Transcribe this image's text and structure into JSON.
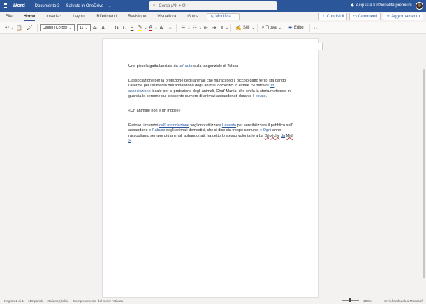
{
  "topbar": {
    "app_name": "Word",
    "doc_title": "Documento 3",
    "save_status": "Salvato in OneDrive",
    "search_placeholder": "Cerca (Alt + Q)",
    "premium_label": "Acquista funzionalità premium"
  },
  "tabs": [
    "File",
    "Home",
    "Inserisci",
    "Layout",
    "Riferimenti",
    "Revisione",
    "Visualizza",
    "Guida"
  ],
  "active_tab": "Home",
  "edit_mode": "Modifica",
  "actions": {
    "share": "Condividi",
    "comments": "Commenti",
    "catchup": "Aggiornamento"
  },
  "ribbon": {
    "font_name": "Calibri (Corpo)",
    "font_size": "11",
    "styles": "Stili",
    "find": "Trova",
    "editor": "Editor"
  },
  "document": {
    "p1_a": "Una piccola gatta lanciata da ",
    "p1_link": "un' auto",
    "p1_b": " sulla tangenziale di Tolosa",
    "p2_a": "L'associazione per la protezione degli animali che ha raccolto il piccolo gatto ferito sta dando l'allarme per l'aumento dell'abbandono degli animali domestici in estate. Si tratta di ",
    "p2_link1": "un' associazione",
    "p2_b": " locale per la protezione degli animali, Chat' Mania, che svela la storia mettendo in guardia le persone sul crescente numero di animali abbandonati durante ",
    "p2_link2": "l' estate",
    "p2_c": ".",
    "p3": "«Un animale non è un mobile»",
    "p4_a": "Furioso, i membri ",
    "p4_link1": "dell' associazione",
    "p4_b": " vogliono utilizzare ",
    "p4_link2": "l' evento",
    "p4_c": " per sensibilizzare il pubblico sull' abbandono e ",
    "p4_link3": "l' abuso",
    "p4_d": " degli animali domestici, che si dice sia troppo comune. ",
    "p4_link4": "« Ogni",
    "p4_e": " anno raccogliamo sempre più animali abbandonati, ha detto lo stesso volontario a La ",
    "p4_red1": "Dépêche",
    "p4_f": " ",
    "p4_link5": "du",
    "p4_g": " ",
    "p4_red2": "Midi",
    "p4_h": "",
    "p4_link6": " »",
    "p4_i": "."
  },
  "status": {
    "page": "Pagina 1 di 1",
    "words": "119 parole",
    "language": "Italiano (Italia)",
    "autocomplete": "Completamento del testo: Attivata",
    "zoom": "100%",
    "feedback": "Invia feedback a Microsoft"
  }
}
